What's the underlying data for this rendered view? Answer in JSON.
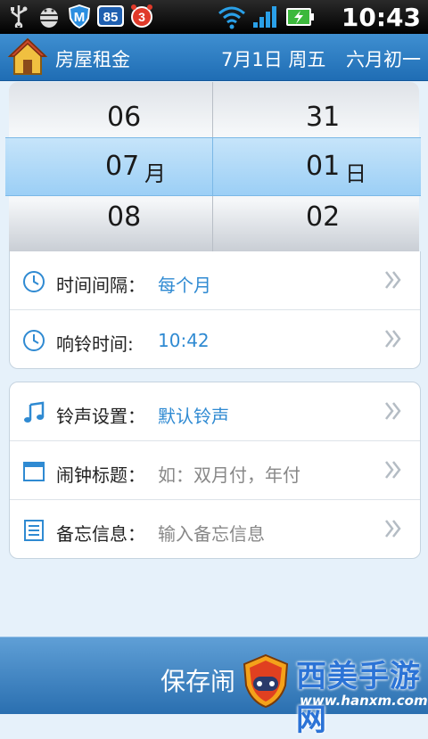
{
  "status_bar": {
    "time": "10:43",
    "badge_85": "85",
    "badge_3": "3",
    "icons": [
      "usb-icon",
      "android-debug-icon",
      "m-shield-icon",
      "notification-85-icon",
      "alarm-3-icon",
      "wifi-icon",
      "signal-icon",
      "battery-icon"
    ]
  },
  "titlebar": {
    "title": "房屋租金",
    "date": "7月1日 周五",
    "lunar": "六月初一"
  },
  "picker": {
    "month_prev": "06",
    "month_selected": "07",
    "month_next": "08",
    "month_unit": "月",
    "day_prev": "31",
    "day_selected": "01",
    "day_next": "02",
    "day_unit": "日"
  },
  "settings": {
    "interval_label": "时间间隔：",
    "interval_value": "每个月",
    "ring_time_label": "响铃时间:",
    "ring_time_value": "10:42",
    "ringtone_label": "铃声设置：",
    "ringtone_value": "默认铃声",
    "title_label": "闹钟标题：",
    "title_placeholder": "如：双月付，年付",
    "memo_label": "备忘信息：",
    "memo_placeholder": "输入备忘信息"
  },
  "bottom": {
    "save_label": "保存闹",
    "watermark_text": "西美手游网",
    "watermark_url": "www.hanxm.com"
  },
  "colors": {
    "accent": "#2f8ad2",
    "titlebar": "#2b7cc4"
  }
}
